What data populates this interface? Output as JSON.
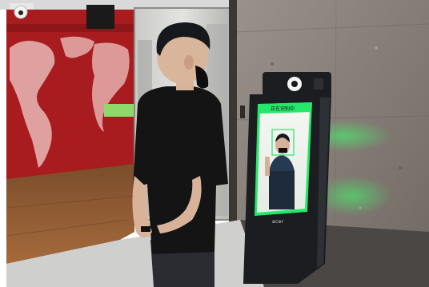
{
  "kiosk": {
    "screen_title": "正在识别中",
    "brand_logo": "acer"
  },
  "colors": {
    "wall_red": "#a81b1e",
    "marble": "#8f8780",
    "kiosk_body": "#1b1d21",
    "screen_bezel": "#23e86a",
    "floor_wood": "#8a5a33",
    "shirt": "#141414"
  }
}
